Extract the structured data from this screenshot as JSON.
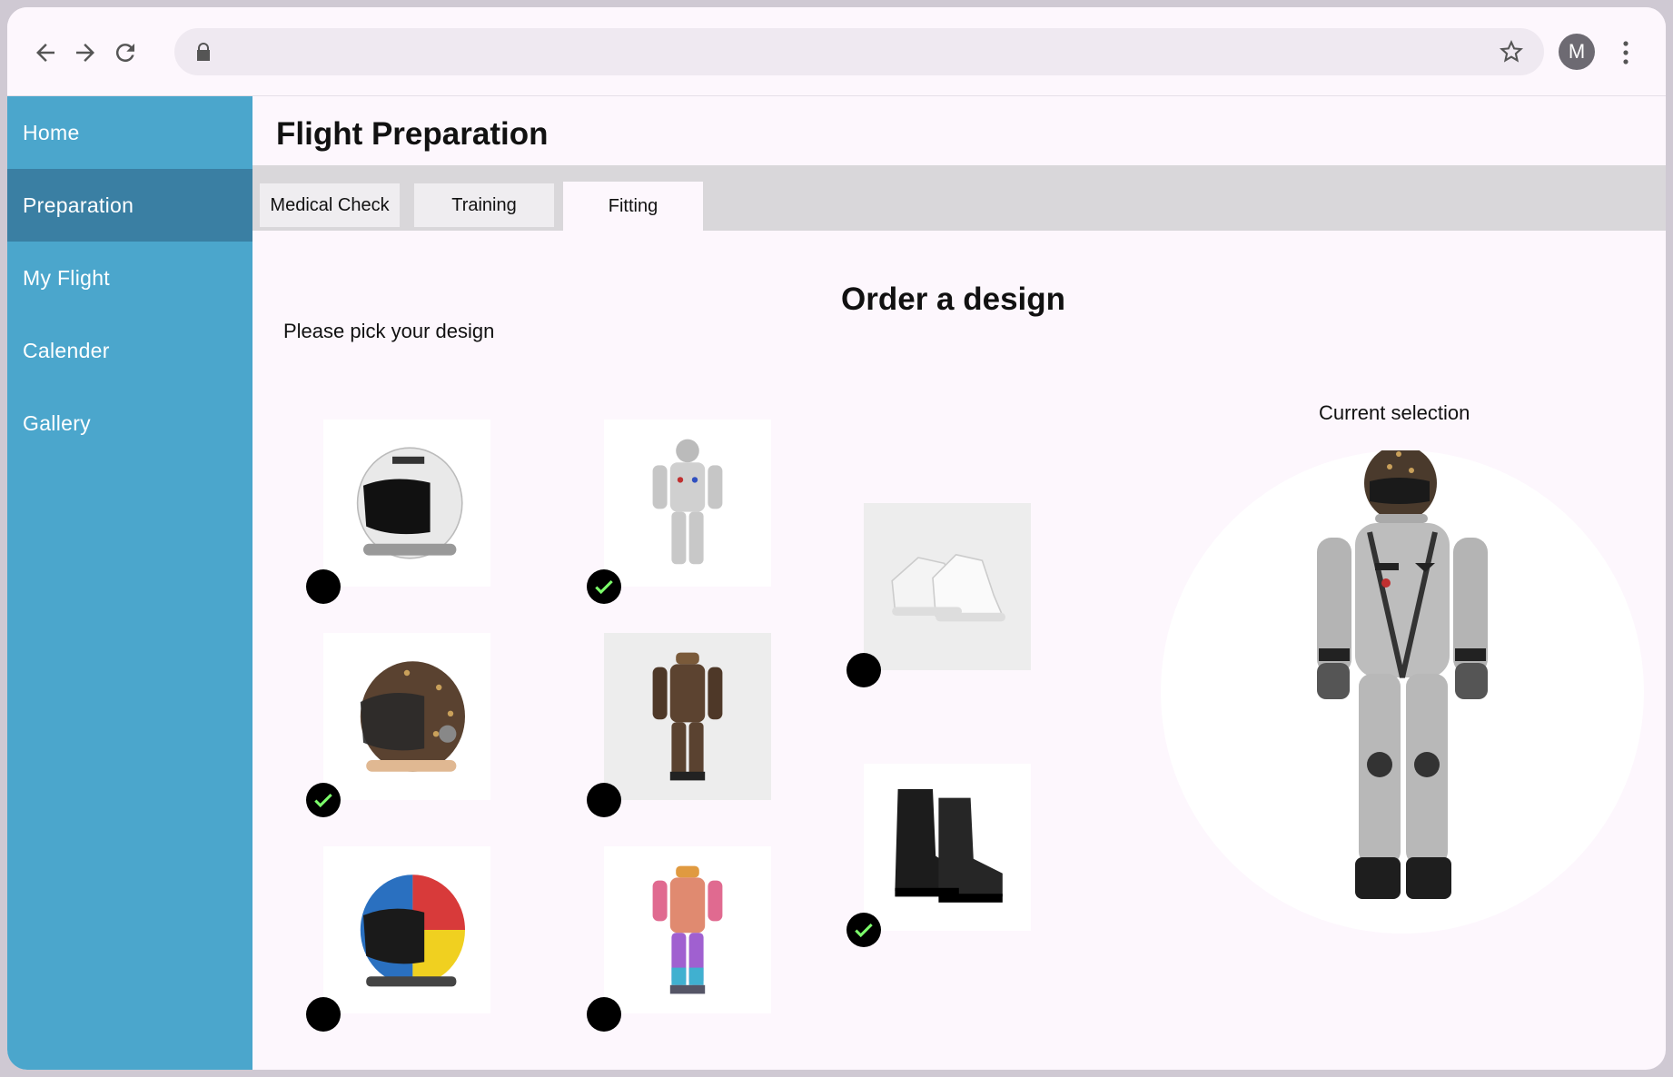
{
  "browser": {
    "url": "",
    "avatar_letter": "M"
  },
  "sidebar": {
    "items": [
      {
        "label": "Home"
      },
      {
        "label": "Preparation",
        "active": true
      },
      {
        "label": "My Flight"
      },
      {
        "label": "Calender"
      },
      {
        "label": "Gallery"
      }
    ]
  },
  "header": {
    "title": "Flight Preparation"
  },
  "tabs": [
    {
      "label": "Medical Check"
    },
    {
      "label": "Training"
    },
    {
      "label": "Fitting",
      "active": true
    }
  ],
  "order": {
    "title": "Order a design",
    "pick_label": "Please pick your design",
    "current_label": "Current selection"
  },
  "designs": {
    "helmets": [
      {
        "name": "white-helmet",
        "selected": false
      },
      {
        "name": "monogram-helmet",
        "selected": true
      },
      {
        "name": "rainbow-helmet",
        "selected": false
      }
    ],
    "suits": [
      {
        "name": "grey-suit",
        "selected": true
      },
      {
        "name": "brown-suit",
        "selected": false
      },
      {
        "name": "colorful-suit",
        "selected": false
      }
    ],
    "boots": [
      {
        "name": "white-sneakers",
        "selected": false
      },
      {
        "name": "black-boots",
        "selected": true
      }
    ]
  },
  "colors": {
    "sidebar": "#4ba6cc",
    "sidebar_active": "#3a7fa3",
    "check": "#7cff6b"
  }
}
